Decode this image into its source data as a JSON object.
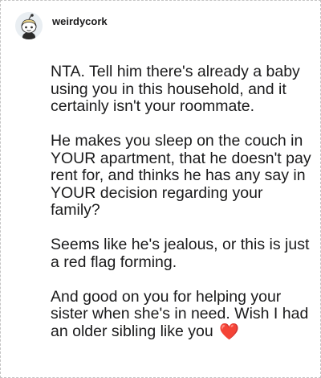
{
  "comment": {
    "username": "weirdycork",
    "paragraphs": [
      "NTA. Tell him there's already a baby using you in this household, and it certainly isn't your roommate.",
      "He makes you sleep on the couch in YOUR apartment, that he doesn't pay rent for, and thinks he has any say in YOUR decision regarding your family?",
      "Seems like he's jealous, or this is just a red flag forming.",
      "And good on you for helping your sister when she's in need. Wish I had an older sibling like you"
    ],
    "emoji": "❤️"
  },
  "icons": {
    "avatar": "reddit-snoo-avatar-icon",
    "heart": "red-heart-emoji-icon"
  },
  "colors": {
    "text": "#1a1a1b",
    "heart": "#e0245e",
    "border": "#c4c4c4"
  }
}
